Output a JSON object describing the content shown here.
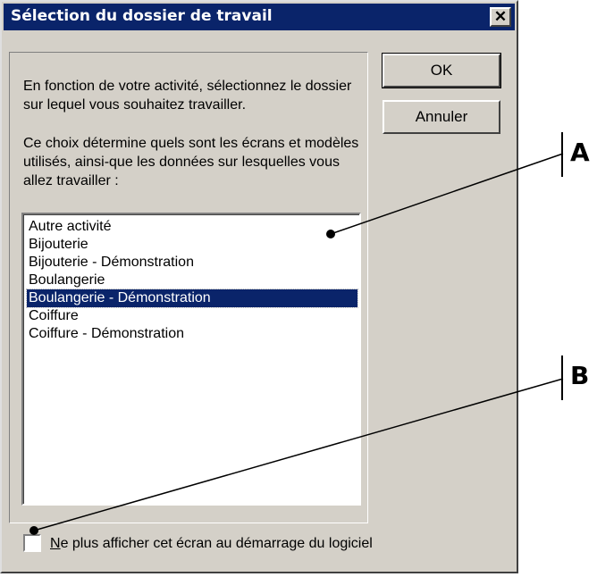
{
  "dialog": {
    "title": "Sélection du dossier de travail",
    "close_label": "✕"
  },
  "description": {
    "paragraph1": "En fonction de votre activité, sélectionnez le dossier sur lequel vous souhaitez travailler.",
    "paragraph2": "Ce choix détermine quels sont les écrans et modèles utilisés, ainsi-que les données sur lesquelles vous allez travailler :"
  },
  "buttons": {
    "ok": "OK",
    "cancel": "Annuler"
  },
  "list": {
    "items": [
      "Autre activité",
      "Bijouterie",
      "Bijouterie - Démonstration",
      "Boulangerie",
      "Boulangerie - Démonstration",
      "Coiffure",
      "Coiffure - Démonstration"
    ],
    "selected_index": 4
  },
  "checkbox": {
    "mnemonic": "N",
    "label_rest": "e plus afficher cet écran au démarrage du logiciel",
    "checked": false
  },
  "callouts": {
    "a": "A",
    "b": "B"
  },
  "colors": {
    "titlebar": "#0a246a",
    "selection": "#0a246a",
    "face": "#d4d0c8"
  }
}
